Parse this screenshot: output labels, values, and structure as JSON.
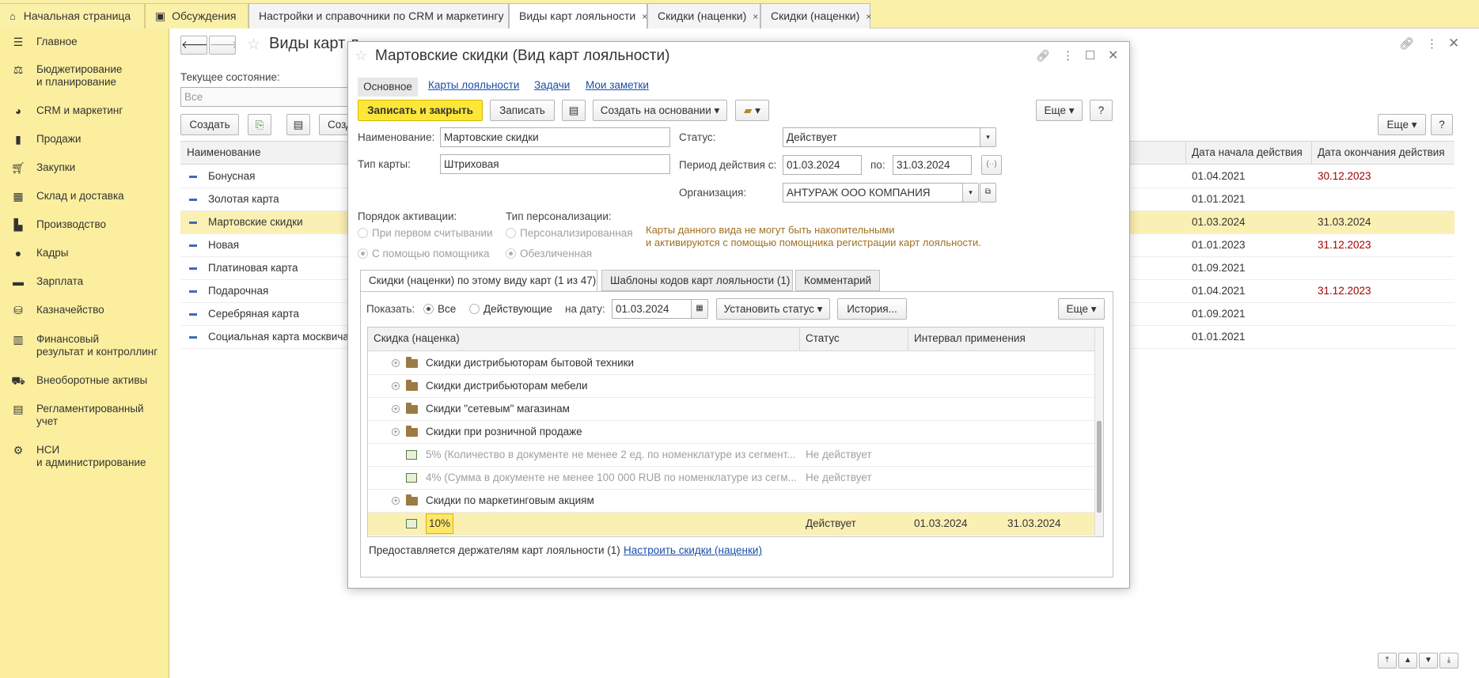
{
  "tabs": [
    {
      "label": "Начальная страница",
      "home": true
    },
    {
      "label": "Обсуждения",
      "chat": true
    },
    {
      "label": "Настройки и справочники по CRM и маркетингу",
      "close": "×"
    },
    {
      "label": "Виды карт лояльности",
      "close": "×",
      "active": true
    },
    {
      "label": "Скидки (наценки)",
      "close": "×"
    },
    {
      "label": "Скидки (наценки)",
      "close": "×"
    }
  ],
  "sidebar": {
    "items": [
      {
        "label": "Главное",
        "icon": "menu-icon"
      },
      {
        "label": "Бюджетирование\nи планирование",
        "icon": "budget-icon"
      },
      {
        "label": "CRM и маркетинг",
        "icon": "crm-icon"
      },
      {
        "label": "Продажи",
        "icon": "sales-icon"
      },
      {
        "label": "Закупки",
        "icon": "cart-icon"
      },
      {
        "label": "Склад и доставка",
        "icon": "warehouse-icon"
      },
      {
        "label": "Производство",
        "icon": "factory-icon"
      },
      {
        "label": "Кадры",
        "icon": "people-icon"
      },
      {
        "label": "Зарплата",
        "icon": "salary-icon"
      },
      {
        "label": "Казначейство",
        "icon": "treasury-icon"
      },
      {
        "label": "Финансовый\nрезультат и контроллинг",
        "icon": "chart-icon"
      },
      {
        "label": "Внеоборотные активы",
        "icon": "assets-icon"
      },
      {
        "label": "Регламентированный\nучет",
        "icon": "accounting-icon"
      },
      {
        "label": "НСИ\nи администрирование",
        "icon": "gear-icon"
      }
    ]
  },
  "list": {
    "title": "Виды карт л",
    "state_label": "Текущее состояние:",
    "state_value": "Все",
    "create_label": "Создать",
    "create2_label": "Созд",
    "more_label": "Еще",
    "help_label": "?",
    "columns": {
      "name": "Наименование",
      "start": "Дата начала действия",
      "end": "Дата окончания действия"
    },
    "rows": [
      {
        "name": "Бонусная",
        "start": "01.04.2021",
        "end": "30.12.2023",
        "end_red": true
      },
      {
        "name": "Золотая карта",
        "start": "01.01.2021",
        "end": ""
      },
      {
        "name": "Мартовские скидки",
        "start": "01.03.2024",
        "end": "31.03.2024",
        "selected": true
      },
      {
        "name": "Новая",
        "start": "01.01.2023",
        "end": "31.12.2023",
        "end_red": true
      },
      {
        "name": "Платиновая карта",
        "start": "01.09.2021",
        "end": ""
      },
      {
        "name": "Подарочная",
        "start": "01.04.2021",
        "end": "31.12.2023",
        "end_red": true
      },
      {
        "name": "Серебряная карта",
        "start": "01.09.2021",
        "end": ""
      },
      {
        "name": "Социальная карта москвича",
        "start": "01.01.2021",
        "end": ""
      }
    ]
  },
  "dialog": {
    "title": "Мартовские скидки (Вид карт лояльности)",
    "nav": [
      "Основное",
      "Карты лояльности",
      "Задачи",
      "Мои заметки"
    ],
    "toolbar": {
      "save_close": "Записать и закрыть",
      "save": "Записать",
      "create_based": "Создать на основании",
      "more": "Еще",
      "help": "?"
    },
    "fields": {
      "name_label": "Наименование:",
      "name_value": "Мартовские скидки",
      "type_label": "Тип карты:",
      "type_value": "Штриховая",
      "status_label": "Статус:",
      "status_value": "Действует",
      "period_label": "Период действия с:",
      "period_from": "01.03.2024",
      "period_to_label": "по:",
      "period_to": "31.03.2024",
      "org_label": "Организация:",
      "org_value": "АНТУРАЖ ООО КОМПАНИЯ"
    },
    "activation": {
      "label": "Порядок активации:",
      "opt1": "При первом считывании",
      "opt2": "С помощью помощника"
    },
    "personalization": {
      "label": "Тип персонализации:",
      "opt1": "Персонализированная",
      "opt2": "Обезличенная"
    },
    "note": "Карты данного вида не могут быть накопительными\nи активируются с помощью помощника регистрации карт лояльности.",
    "tabs": [
      "Скидки (наценки) по этому виду карт (1 из 47)",
      "Шаблоны кодов карт лояльности (1)",
      "Комментарий"
    ],
    "filter": {
      "show_label": "Показать:",
      "all": "Все",
      "active": "Действующие",
      "date_label": "на дату:",
      "date_value": "01.03.2024",
      "set_status": "Установить статус",
      "history": "История...",
      "more": "Еще"
    },
    "table": {
      "columns": {
        "name": "Скидка (наценка)",
        "status": "Статус",
        "interval": "Интервал применения"
      },
      "rows": [
        {
          "name": "Скидки дистрибьюторам бытовой техники",
          "kind": "group",
          "expand": "+",
          "status": "",
          "from": "",
          "to": ""
        },
        {
          "name": "Скидки дистрибьюторам мебели",
          "kind": "group",
          "expand": "+",
          "status": "",
          "from": "",
          "to": ""
        },
        {
          "name": "Скидки \"сетевым\" магазинам",
          "kind": "folder",
          "expand": "+",
          "status": "",
          "from": "",
          "to": ""
        },
        {
          "name": "Скидки при розничной продаже",
          "kind": "folder",
          "expand": "+",
          "status": "",
          "from": "",
          "to": ""
        },
        {
          "name": "5% (Количество в документе не менее 2 ед. по номенклатуре из сегмент...",
          "kind": "item",
          "dim": true,
          "status": "Не действует",
          "from": "",
          "to": ""
        },
        {
          "name": "4% (Сумма в документе не менее 100 000 RUB по номенклатуре из сегм...",
          "kind": "item",
          "dim": true,
          "status": "Не действует",
          "from": "",
          "to": ""
        },
        {
          "name": "Скидки по маркетинговым акциям",
          "kind": "folder",
          "expand": "+",
          "status": "",
          "from": "",
          "to": ""
        },
        {
          "name": "10%",
          "kind": "item",
          "selected": true,
          "status": "Действует",
          "from": "01.03.2024",
          "to": "31.03.2024"
        }
      ]
    },
    "footer": {
      "text": "Предоставляется держателям карт лояльности (1)",
      "link": "Настроить скидки (наценки)"
    }
  }
}
